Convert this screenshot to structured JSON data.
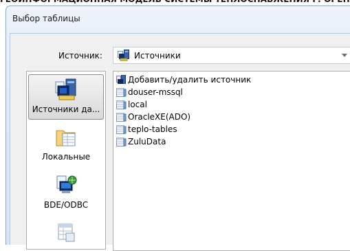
{
  "header_strip": {
    "text": "ГЕОИНФОРМАЦИОННАЯ МОДЕЛЬ СИСТЕМЫ ТЕПЛОСНАБЖЕНИЯ Г. ОРЕНБУРГ"
  },
  "dialog": {
    "title": "Выбор таблицы"
  },
  "source": {
    "label": "Источник:",
    "selected": "Источники",
    "icon": "data-sources-icon"
  },
  "sidebar": {
    "items": [
      {
        "label": "Источники да...",
        "icon": "data-sources-icon",
        "selected": true
      },
      {
        "label": "Локальные",
        "icon": "local-folder-icon",
        "selected": false
      },
      {
        "label": "BDE/ODBC",
        "icon": "bde-odbc-icon",
        "selected": false
      },
      {
        "label": "",
        "icon": "table-icon",
        "selected": false
      }
    ]
  },
  "list": {
    "items": [
      {
        "label": "Добавить/удалить источник",
        "icon": "add-remove-source-icon"
      },
      {
        "label": "douser-mssql",
        "icon": "database-icon"
      },
      {
        "label": "local",
        "icon": "database-icon"
      },
      {
        "label": "OracleXE(ADO)",
        "icon": "database-icon"
      },
      {
        "label": "teplo-tables",
        "icon": "database-icon"
      },
      {
        "label": "ZuluData",
        "icon": "database-icon"
      }
    ]
  },
  "colors": {
    "window_border": "#8fa6c4",
    "panel_bg": "#ffffff",
    "client_bg": "#f0f0f0"
  }
}
